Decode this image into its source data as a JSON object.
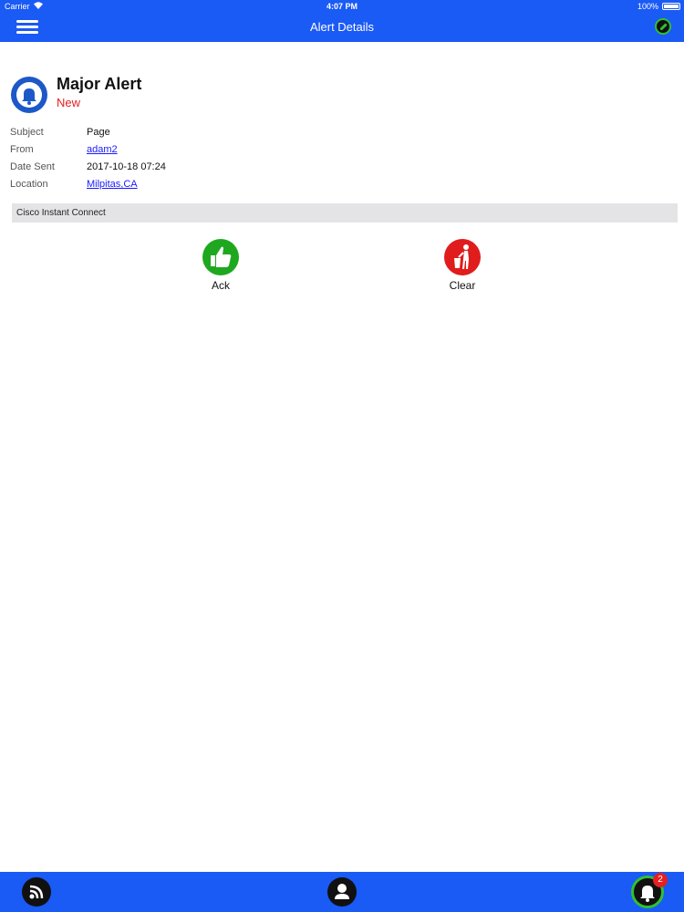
{
  "status_bar": {
    "carrier": "Carrier",
    "time": "4:07 PM",
    "battery": "100%"
  },
  "header": {
    "title": "Alert Details"
  },
  "alert": {
    "title": "Major Alert",
    "status": "New"
  },
  "details": [
    {
      "label": "Subject",
      "value": "Page"
    },
    {
      "label": "From",
      "value": "adam2"
    },
    {
      "label": "Date Sent",
      "value": "2017-10-18 07:24"
    },
    {
      "label": "Location",
      "value": "Milpitas,CA"
    }
  ],
  "banner": {
    "text": "Cisco Instant Connect"
  },
  "actions": {
    "ack_label": "Ack",
    "clear_label": "Clear"
  },
  "bottom_bar": {
    "alerts_badge": "2"
  },
  "colors": {
    "accent": "#1a5af5",
    "status_new": "#e42020",
    "ack": "#1fa81f",
    "clear": "#e01c1c",
    "online": "#2fc12f"
  },
  "icons": [
    "menu-icon",
    "link-status-icon",
    "bell-icon",
    "thumbs-up-icon",
    "trash-icon",
    "feed-icon",
    "person-icon",
    "bell-icon"
  ]
}
